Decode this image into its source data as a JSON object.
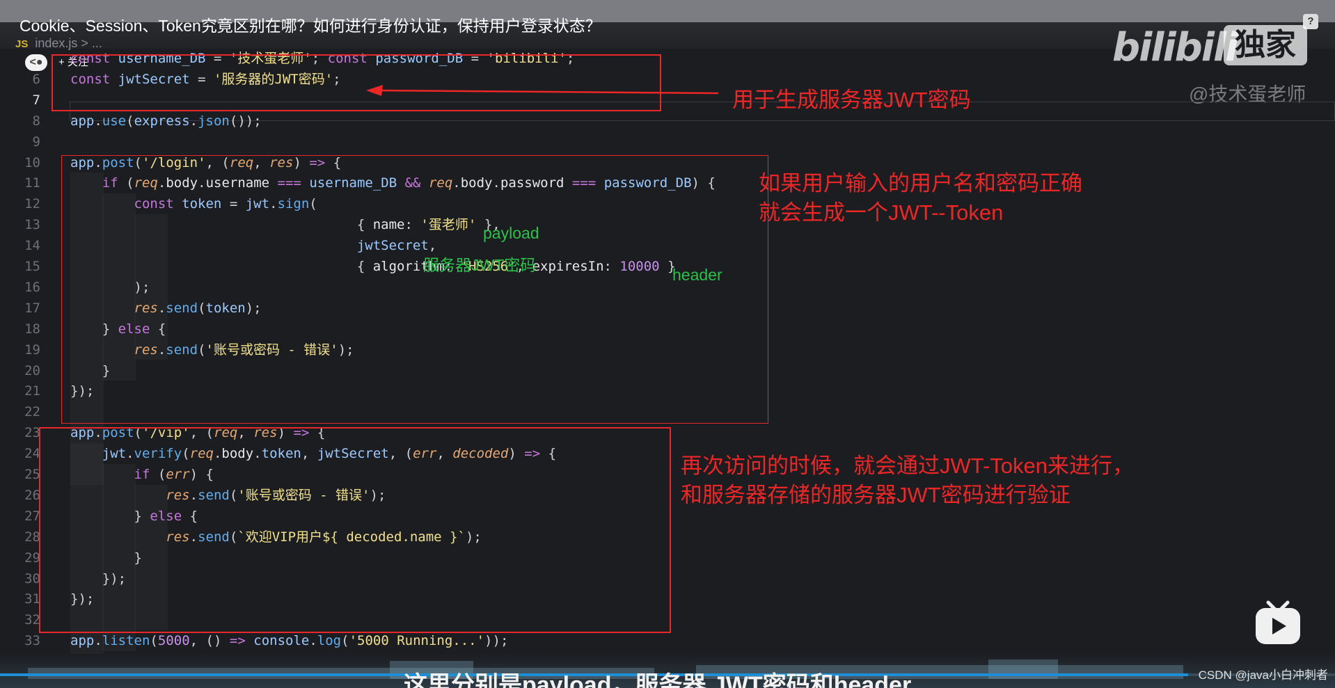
{
  "video": {
    "title": "Cookie、Session、Token究竟区别在哪？如何进行身份认证，保持用户登录状态？",
    "help_label": "?",
    "up_avatar": "<●",
    "follow_label": "+ 关注",
    "logo_text": "bilibili",
    "logo_badge": "独家",
    "watermark": "@技术蛋老师",
    "subtitle": "这里分别是payload，服务器 JWT密码和header",
    "csdn_watermark": "CSDN @java小白冲刺者",
    "progress_fraction": 0.89
  },
  "editor": {
    "file_icon": "JS",
    "breadcrumb": "index.js > ..."
  },
  "code_lines": [
    {
      "n": "",
      "t": "const username_DB = '技术蛋老师'; const password_DB = 'bilibili';"
    },
    {
      "n": "6",
      "t": "const jwtSecret = '服务器的JWT密码';"
    },
    {
      "n": "7",
      "t": ""
    },
    {
      "n": "8",
      "t": "app.use(express.json());"
    },
    {
      "n": "9",
      "t": ""
    },
    {
      "n": "10",
      "t": "app.post('/login', (req, res) => {"
    },
    {
      "n": "11",
      "t": "    if (req.body.username === username_DB && req.body.password === password_DB) {"
    },
    {
      "n": "12",
      "t": "        const token = jwt.sign("
    },
    {
      "n": "13",
      "t": "                                    { name: '蛋老师' },"
    },
    {
      "n": "14",
      "t": "                                    jwtSecret,"
    },
    {
      "n": "15",
      "t": "                                    { algorithm: 'HS256', expiresIn: 10000 }"
    },
    {
      "n": "16",
      "t": "        );"
    },
    {
      "n": "17",
      "t": "        res.send(token);"
    },
    {
      "n": "18",
      "t": "    } else {"
    },
    {
      "n": "19",
      "t": "        res.send('账号或密码 - 错误');"
    },
    {
      "n": "20",
      "t": "    }"
    },
    {
      "n": "21",
      "t": "});"
    },
    {
      "n": "22",
      "t": ""
    },
    {
      "n": "23",
      "t": "app.post('/vip', (req, res) => {"
    },
    {
      "n": "24",
      "t": "    jwt.verify(req.body.token, jwtSecret, (err, decoded) => {"
    },
    {
      "n": "25",
      "t": "        if (err) {"
    },
    {
      "n": "26",
      "t": "            res.send('账号或密码 - 错误');"
    },
    {
      "n": "27",
      "t": "        } else {"
    },
    {
      "n": "28",
      "t": "            res.send(`欢迎VIP用户${ decoded.name }`);"
    },
    {
      "n": "29",
      "t": "        }"
    },
    {
      "n": "30",
      "t": "    });"
    },
    {
      "n": "31",
      "t": "});"
    },
    {
      "n": "32",
      "t": ""
    },
    {
      "n": "33",
      "t": "app.listen(5000, () => console.log('5000 Running...'));"
    }
  ],
  "annotations": {
    "secret_note": "用于生成服务器JWT密码",
    "login_note_1": "如果用户输入的用户名和密码正确",
    "login_note_2": "就会生成一个JWT--Token",
    "payload_tag": "payload",
    "secret_tag": "服务器JWT密码",
    "header_tag": "header",
    "verify_note_1": "再次访问的时候，就会通过JWT-Token来进行，",
    "verify_note_2": "和服务器存储的服务器JWT密码进行验证"
  },
  "colors": {
    "annotation_red": "#ee2626",
    "annotation_green": "#2ac14a",
    "progress_blue": "#1e8fd6"
  }
}
